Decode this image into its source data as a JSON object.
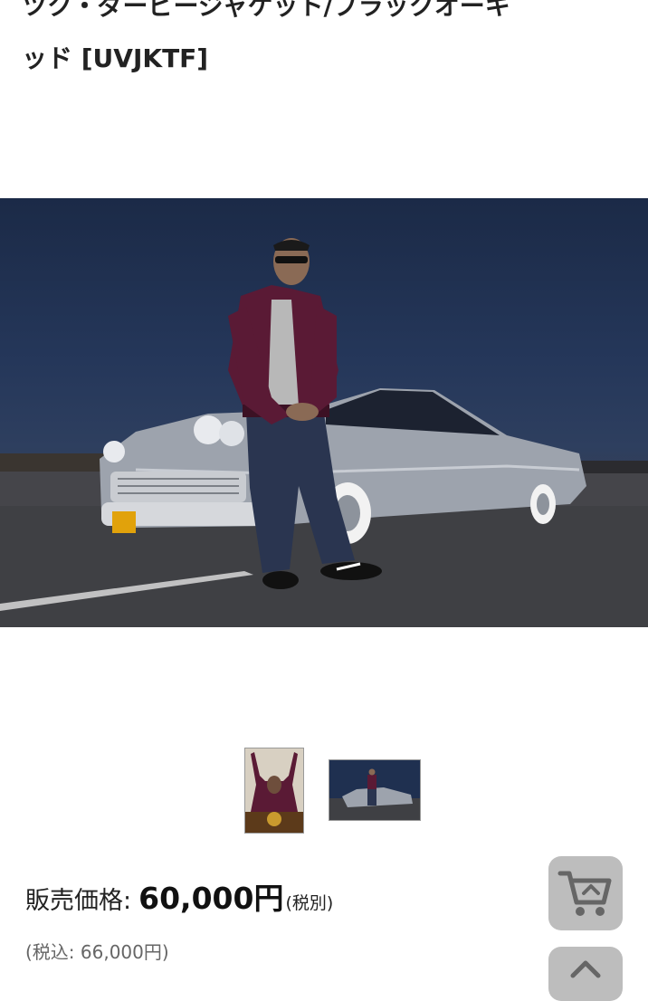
{
  "product": {
    "title_line_1": "ツク・ダービージャケット/ブラックオーキ",
    "title_line_2": "ッド [UVJKTF]",
    "hero_image_alt": "Man in a maroon bomber jacket standing in front of a silver vintage car at dusk",
    "thumbnails": [
      {
        "alt": "Model in maroon jacket posing with arms raised"
      },
      {
        "alt": "Man in maroon jacket in front of vintage car"
      }
    ]
  },
  "price": {
    "label": "販売価格:",
    "value": "60,000円",
    "tax_note": "(税別)",
    "tax_included": "(税込: 66,000円)"
  },
  "floating_buttons": {
    "cart_icon": "cart-icon",
    "scroll_top_icon": "chevron-up-icon"
  },
  "colors": {
    "fab_background": "#bdbdbd",
    "fab_icon": "#666666",
    "jacket_maroon": "#5a1a35"
  }
}
